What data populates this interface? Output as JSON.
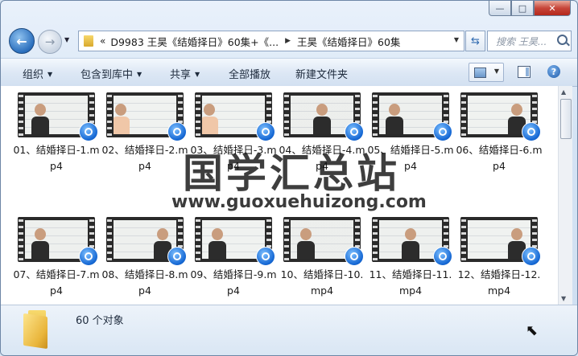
{
  "window": {
    "min_symbol": "—",
    "max_symbol": "□",
    "close_symbol": "✕"
  },
  "address": {
    "chevron": "«",
    "crumbs": [
      "D9983 王昊《结婚择日》60集+《...",
      "王昊《结婚择日》60集"
    ],
    "separator": "▶"
  },
  "search": {
    "placeholder": "搜索 王昊..."
  },
  "toolbar": {
    "organize": "组织",
    "include_library": "包含到库中",
    "share": "共享",
    "play_all": "全部播放",
    "new_folder": "新建文件夹"
  },
  "files": [
    {
      "name": "01、结婚择日-1.mp4",
      "bg": "#e9ece8",
      "coat": "#2c2c2c",
      "pos": "left"
    },
    {
      "name": "02、结婚择日-2.mp4",
      "bg": "#eef0ee",
      "coat": "#f0c7a8",
      "pos": "left-edge"
    },
    {
      "name": "03、结婚择日-3.mp4",
      "bg": "#eef0ee",
      "coat": "#f0c7a8",
      "pos": "left-edge"
    },
    {
      "name": "04、结婚择日-4.mp4",
      "bg": "#e6e8e6",
      "coat": "#2c2c2c",
      "pos": "center"
    },
    {
      "name": "05、结婚择日-5.mp4",
      "bg": "#e9ece8",
      "coat": "#2c2c2c",
      "pos": "left"
    },
    {
      "name": "06、结婚择日-6.mp4",
      "bg": "#eef0ee",
      "coat": "#2c2c2c",
      "pos": "right"
    },
    {
      "name": "07、结婚择日-7.mp4",
      "bg": "#eaecea",
      "coat": "#2c2c2c",
      "pos": "left"
    },
    {
      "name": "08、结婚择日-8.mp4",
      "bg": "#eaecea",
      "coat": "#2c2c2c",
      "pos": "right"
    },
    {
      "name": "09、结婚择日-9.mp4",
      "bg": "#eef0ee",
      "coat": "#2c2c2c",
      "pos": "left"
    },
    {
      "name": "10、结婚择日-10.mp4",
      "bg": "#e6e8e6",
      "coat": "#2c2c2c",
      "pos": "left"
    },
    {
      "name": "11、结婚择日-11.mp4",
      "bg": "#e9ece8",
      "coat": "#2c2c2c",
      "pos": "center"
    },
    {
      "name": "12、结婚择日-12.mp4",
      "bg": "#eef0ee",
      "coat": "#2c2c2c",
      "pos": "right"
    }
  ],
  "watermark": {
    "title": "国学汇总站",
    "url": "www.guoxuehuizong.com"
  },
  "status": {
    "count": "60 个对象"
  }
}
